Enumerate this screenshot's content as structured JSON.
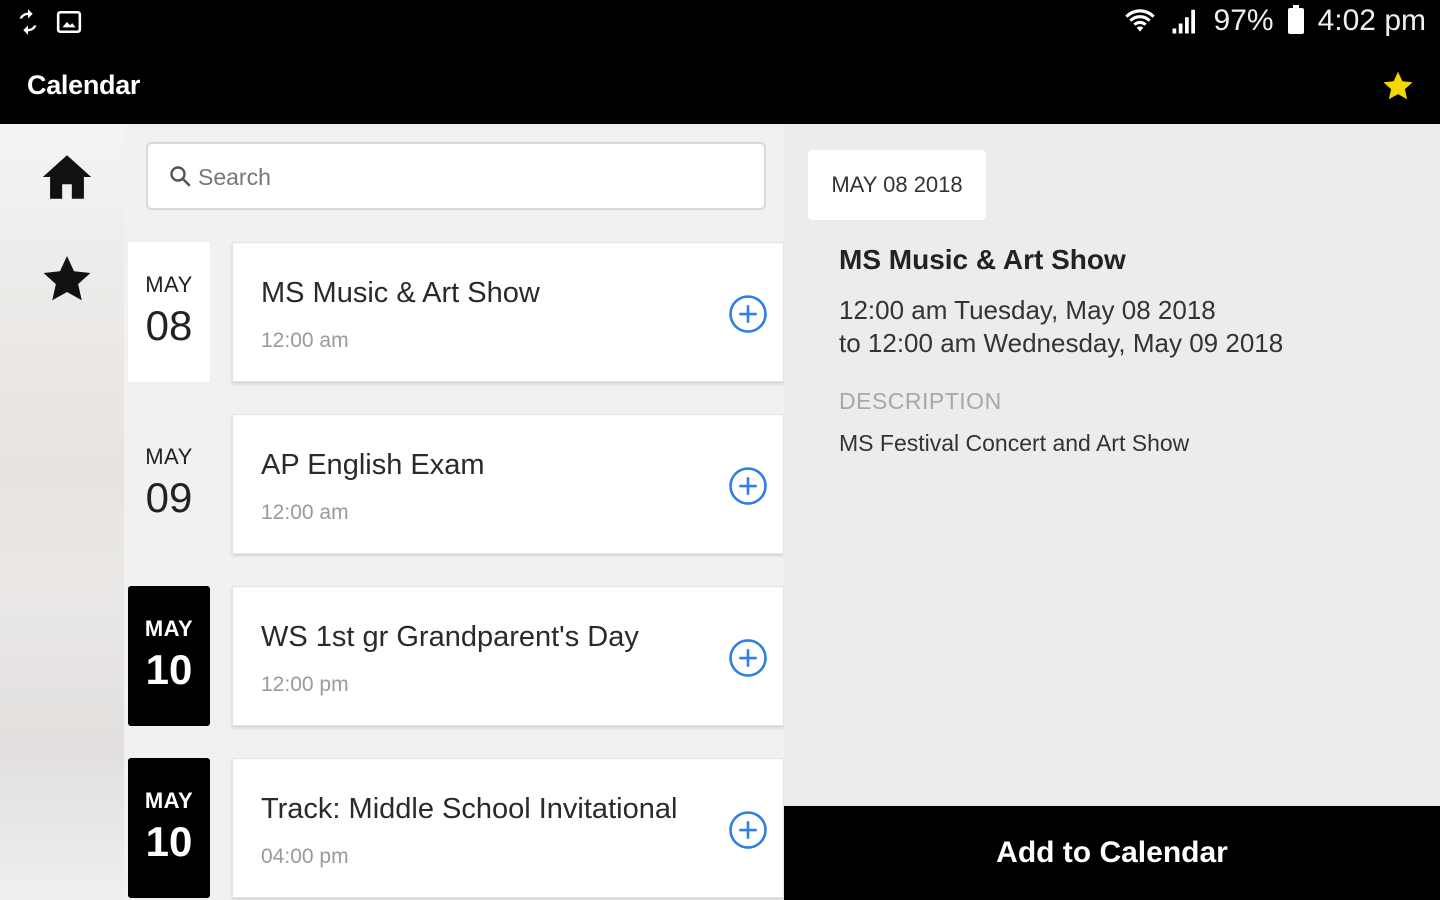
{
  "status_bar": {
    "battery": "97%",
    "time": "4:02 pm",
    "icons": [
      "sync-icon",
      "image-icon",
      "wifi-icon",
      "signal-icon",
      "battery-icon"
    ]
  },
  "app_bar": {
    "title": "Calendar",
    "favorite_icon": "star-icon",
    "favorite_color": "#f5d800"
  },
  "side_rail": {
    "items": [
      {
        "icon": "home-icon"
      },
      {
        "icon": "star-icon"
      }
    ]
  },
  "search": {
    "placeholder": "Search",
    "value": ""
  },
  "events": [
    {
      "month": "MAY",
      "day": "08",
      "title": "MS Music & Art Show",
      "time": "12:00 am",
      "highlight": false,
      "add_icon": "plus-circle-icon"
    },
    {
      "month": "MAY",
      "day": "09",
      "title": "AP English Exam",
      "time": "12:00 am",
      "highlight": false,
      "add_icon": "plus-circle-icon"
    },
    {
      "month": "MAY",
      "day": "10",
      "title": "WS 1st gr Grandparent's Day",
      "time": "12:00 pm",
      "highlight": true,
      "add_icon": "plus-circle-icon"
    },
    {
      "month": "MAY",
      "day": "10",
      "title": "Track: Middle School Invitational",
      "time": "04:00 pm",
      "highlight": true,
      "add_icon": "plus-circle-icon"
    }
  ],
  "detail": {
    "date_chip": "MAY 08 2018",
    "title": "MS Music & Art Show",
    "when_line1": "12:00 am Tuesday, May 08 2018",
    "when_line2": "to 12:00 am Wednesday, May 09 2018",
    "description_label": "DESCRIPTION",
    "description": "MS Festival Concert and Art Show"
  },
  "add_to_calendar_label": "Add to Calendar",
  "colors": {
    "accent": "#2f7fe6",
    "bar_background": "#000000"
  }
}
